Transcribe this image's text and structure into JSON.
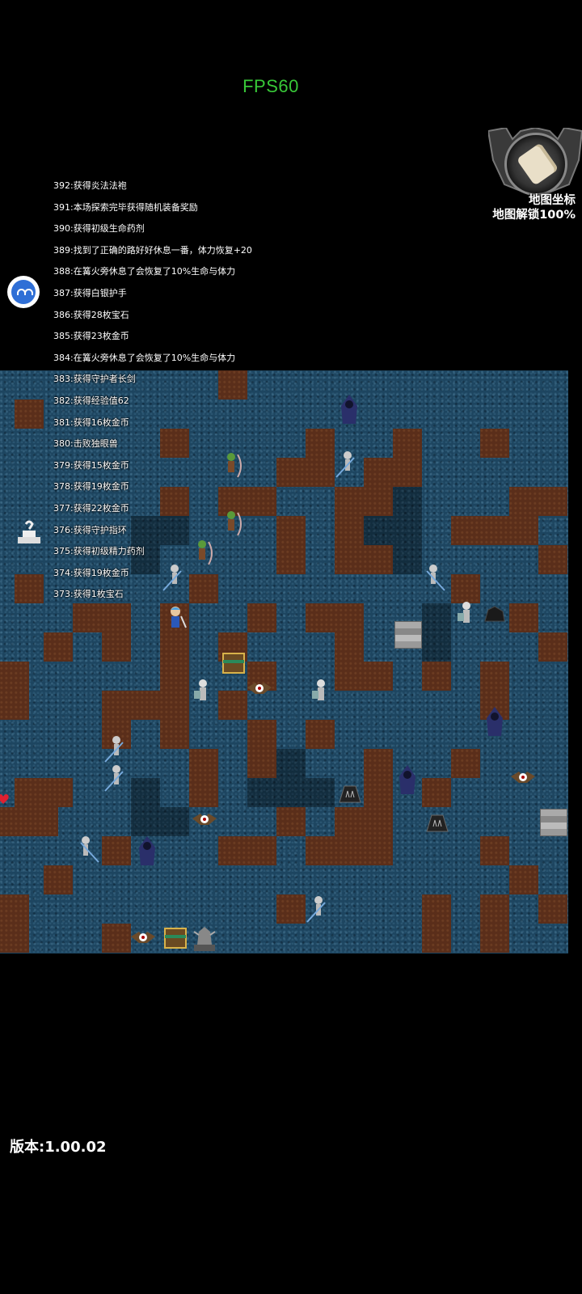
{
  "hud": {
    "fps_text": "FPS60",
    "version_text": "版本:1.00.02",
    "map_button": {
      "title": "地图坐标",
      "subtitle": "地图解锁100%",
      "icon": "scroll-icon"
    },
    "assistant_icon": "assistant-bubble-icon",
    "altar_icon": "altar-icon"
  },
  "colors": {
    "fps": "#38c838",
    "water": "#1d4560",
    "dirt": "#5a2e1a"
  },
  "log": [
    "392:获得炎法法袍",
    "391:本场探索完毕获得随机装备奖励",
    "390:获得初级生命药剂",
    "389:找到了正确的路好好休息一番，体力恢复+20",
    "388:在篝火旁休息了会恢复了10%生命与体力",
    "387:获得白银护手",
    "386:获得28枚宝石",
    "385:获得23枚金币",
    "384:在篝火旁休息了会恢复了10%生命与体力",
    "383:获得守护者长剑",
    "382:获得经验值62",
    "381:获得16枚金币",
    "380:击败独眼兽",
    "379:获得15枚金币",
    "378:获得19枚金币",
    "377:获得22枚金币",
    "376:获得守护指环",
    "375:获得初级精力药剂",
    "374:获得19枚金币",
    "373:获得1枚宝石"
  ],
  "map": {
    "entities": [
      {
        "kind": "hooded-wraith"
      },
      {
        "kind": "skeleton-spearman"
      },
      {
        "kind": "goblin-archer"
      },
      {
        "kind": "goblin-archer"
      },
      {
        "kind": "goblin-archer"
      },
      {
        "kind": "skeleton-spearman"
      },
      {
        "kind": "skeleton-spearman"
      },
      {
        "kind": "player-hero"
      },
      {
        "kind": "skeleton-knight"
      },
      {
        "kind": "black-ore"
      },
      {
        "kind": "stairs-down"
      },
      {
        "kind": "treasure-chest"
      },
      {
        "kind": "skeleton-knight"
      },
      {
        "kind": "eyeball-bat"
      },
      {
        "kind": "skeleton-knight"
      },
      {
        "kind": "hooded-wraith"
      },
      {
        "kind": "skeleton-spearman"
      },
      {
        "kind": "skeleton-spearman"
      },
      {
        "kind": "hooded-wraith"
      },
      {
        "kind": "eyeball-bat"
      },
      {
        "kind": "spike-trap"
      },
      {
        "kind": "spike-trap"
      },
      {
        "kind": "eyeball-bat"
      },
      {
        "kind": "stairs-up"
      },
      {
        "kind": "skeleton-spearman"
      },
      {
        "kind": "hooded-wraith"
      },
      {
        "kind": "skeleton-spearman"
      },
      {
        "kind": "eyeball-bat"
      },
      {
        "kind": "treasure-chest"
      },
      {
        "kind": "gargoyle-statue"
      },
      {
        "kind": "heart-pickup"
      }
    ]
  }
}
